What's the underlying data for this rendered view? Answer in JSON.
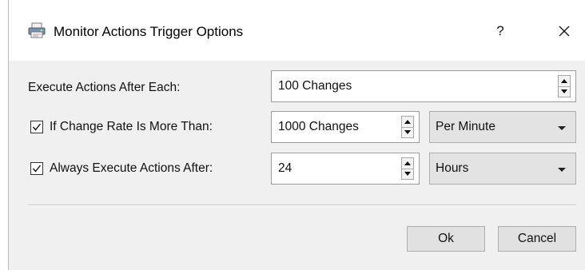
{
  "window": {
    "title": "Monitor Actions Trigger Options",
    "help_label": "?",
    "app_icon": "printer-app-icon",
    "close_icon": "close-icon"
  },
  "rows": [
    {
      "label": "Execute Actions After Each:",
      "has_checkbox": false,
      "field_value": "100 Changes"
    },
    {
      "label": "If Change Rate Is More Than:",
      "has_checkbox": true,
      "checked": true,
      "field_value": "1000 Changes",
      "unit_selected": "Per Minute"
    },
    {
      "label": "Always Execute Actions After:",
      "has_checkbox": true,
      "checked": true,
      "field_value": "24",
      "unit_selected": "Hours"
    }
  ],
  "buttons": {
    "ok_label": "Ok",
    "cancel_label": "Cancel"
  },
  "colors": {
    "dialog_bg": "#f0f0f0",
    "titlebar_bg": "#ffffff",
    "field_border": "#9c9c9c",
    "button_bg": "#e1e1e1"
  }
}
